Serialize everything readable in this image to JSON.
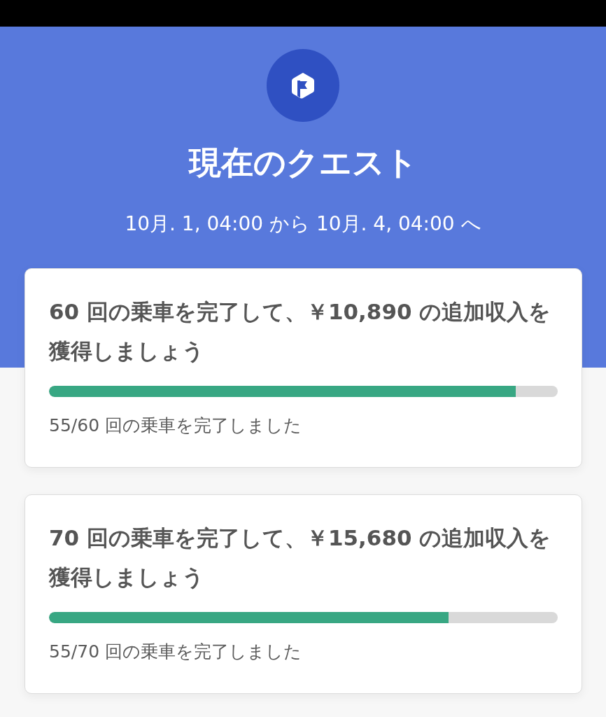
{
  "header": {
    "title": "現在のクエスト",
    "date_range": "10月. 1, 04:00 から 10月. 4, 04:00 へ"
  },
  "quests": [
    {
      "title": "60 回の乗車を完了して、￥10,890 の追加収入を獲得しましょう",
      "level": 0.917,
      "progress_text": "55/60 回の乗車を完了しました"
    },
    {
      "title": "70 回の乗車を完了して、￥15,680 の追加収入を獲得しましょう",
      "level": 0.786,
      "progress_text": "55/70 回の乗車を完了しました"
    }
  ]
}
